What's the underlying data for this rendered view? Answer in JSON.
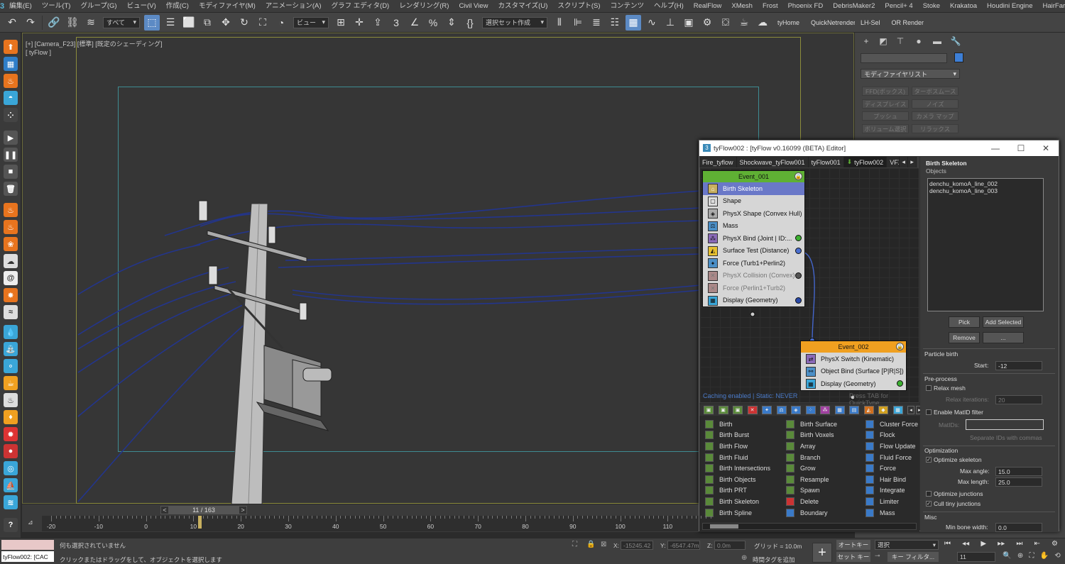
{
  "menubar": {
    "app_icon": "3",
    "items": [
      "編集(E)",
      "ツール(T)",
      "グループ(G)",
      "ビュー(V)",
      "作成(C)",
      "モディファイヤ(M)",
      "アニメーション(A)",
      "グラフ エディタ(D)",
      "レンダリング(R)",
      "Civil View",
      "カスタマイズ(U)",
      "スクリプト(S)",
      "コンテンツ",
      "ヘルプ(H)",
      "RealFlow",
      "XMesh",
      "Frost",
      "Phoenix FD",
      "DebrisMaker2",
      "Pencil+ 4",
      "Stoke",
      "Krakatoa",
      "Houdini Engine",
      "HairFarm"
    ]
  },
  "toolbar": {
    "selection_filter": "すべて",
    "ref_coord": "ビュー",
    "named_selection": "選択セット作成",
    "custom": [
      "tyHome",
      "QuickNetrender",
      "LH-Sel",
      "OR Render"
    ]
  },
  "viewport": {
    "label_line1": "[+] [Camera_F23] [標準] [既定のシェーディング]",
    "label_line2": "[ tyFlow ]"
  },
  "command_panel": {
    "modifier_list": "モディファイヤリスト",
    "buttons": [
      [
        "FFD(ボックス)",
        "ターボスムース"
      ],
      [
        "ディスプレイス",
        "ノイズ"
      ],
      [
        "プッシュ",
        "カメラ マップ"
      ],
      [
        "ボリューム選択",
        "リラックス"
      ]
    ],
    "accent_color": "#3d7fd6"
  },
  "tyflow": {
    "window_title": "tyFlow002 : [tyFlow v0.16099 (BETA) Editor]",
    "window_icon": "3",
    "min_icon": "—",
    "max_icon": "☐",
    "close_icon": "✕",
    "tabs": [
      "Fire_tyflow",
      "Shockwave_tyFlow001",
      "tyFlow001",
      "tyFlow002",
      "VFX"
    ],
    "active_tab": "tyFlow002",
    "event1": {
      "name": "Event_001",
      "header_color": "#5fb034",
      "operators": [
        {
          "label": "Birth Skeleton",
          "selected": true,
          "disabled": false
        },
        {
          "label": "Shape",
          "selected": false,
          "disabled": false
        },
        {
          "label": "PhysX Shape (Convex Hull)",
          "selected": false,
          "disabled": false
        },
        {
          "label": "Mass",
          "selected": false,
          "disabled": false
        },
        {
          "label": "PhysX Bind (Joint | ID:...",
          "selected": false,
          "disabled": false
        },
        {
          "label": "Surface Test (Distance)",
          "selected": false,
          "disabled": false
        },
        {
          "label": "Force (Turb1+Perlin2)",
          "selected": false,
          "disabled": false
        },
        {
          "label": "PhysX Collision (Convex)",
          "selected": false,
          "disabled": true
        },
        {
          "label": "Force (Perlin1+Turb2)",
          "selected": false,
          "disabled": true
        },
        {
          "label": "Display (Geometry)",
          "selected": false,
          "disabled": false
        }
      ]
    },
    "event2": {
      "name": "Event_002",
      "header_color": "#f0a020",
      "operators": [
        {
          "label": "PhysX Switch (Kinematic)",
          "selected": false,
          "disabled": false
        },
        {
          "label": "Object Bind (Surface [P|R|S])",
          "selected": false,
          "disabled": false
        },
        {
          "label": "Display (Geometry)",
          "selected": false,
          "disabled": false
        }
      ]
    },
    "status_text": "Caching enabled | Static: NEVER",
    "hint_text": "Press TAB for QuickType",
    "palette": {
      "col1": [
        "Birth",
        "Birth Burst",
        "Birth Flow",
        "Birth Fluid",
        "Birth Intersections",
        "Birth Objects",
        "Birth PRT",
        "Birth Skeleton",
        "Birth Spline"
      ],
      "col2": [
        "Birth Surface",
        "Birth Voxels",
        "Array",
        "Branch",
        "Grow",
        "Resample",
        "Spawn",
        "Delete",
        "Boundary"
      ],
      "col3": [
        "Cluster Force",
        "Flock",
        "Flow Update",
        "Fluid Force",
        "Force",
        "Hair Bind",
        "Integrate",
        "Limiter",
        "Mass"
      ]
    },
    "props": {
      "title": "Birth Skeleton",
      "objects_label": "Objects",
      "objects": [
        "denchu_komoA_line_002",
        "denchu_komoA_line_003"
      ],
      "pick": "Pick",
      "add_selected": "Add Selected",
      "remove": "Remove",
      "more": "...",
      "particle_birth": "Particle birth",
      "start_label": "Start:",
      "start_value": "-12",
      "preprocess": "Pre-process",
      "relax_mesh": "Relax mesh",
      "relax_iter_label": "Relax iterations:",
      "relax_iter_value": "20",
      "enable_matid": "Enable MatID filter",
      "matids_label": "MatIDs:",
      "matids_hint": "Separate IDs with commas",
      "optimization": "Optimization",
      "optimize_skeleton": "Optimize skeleton",
      "max_angle_label": "Max angle:",
      "max_angle_value": "15.0",
      "max_length_label": "Max length:",
      "max_length_value": "25.0",
      "optimize_junctions": "Optimize junctions",
      "cull_tiny": "Cull tiny junctions",
      "misc": "Misc",
      "min_bone_label": "Min bone width:",
      "min_bone_value": "0.0"
    }
  },
  "timeline": {
    "frame": "11 / 163",
    "prev_arrow": "<",
    "next_arrow": ">",
    "ticks": [
      "-20",
      "-10",
      "0",
      "10",
      "20",
      "30",
      "40",
      "50",
      "60",
      "70",
      "80",
      "90",
      "100",
      "110"
    ]
  },
  "status": {
    "script_listener": "tyFlow002: [CAC",
    "line1": "何も選択されていません",
    "line2": "クリックまたはドラッグをして、オブジェクトを選択します",
    "x_label": "X:",
    "x_value": "-15245.42",
    "y_label": "Y:",
    "y_value": "-6547.47m",
    "z_label": "Z:",
    "z_value": "0.0m",
    "grid": "グリッド = 10.0m",
    "add_time_tag": "時間タグを追加",
    "auto_key": "オートキー",
    "set_key": "セット キー",
    "selection": "選択",
    "key_filter": "キー フィルタ...",
    "current_frame": "11"
  }
}
